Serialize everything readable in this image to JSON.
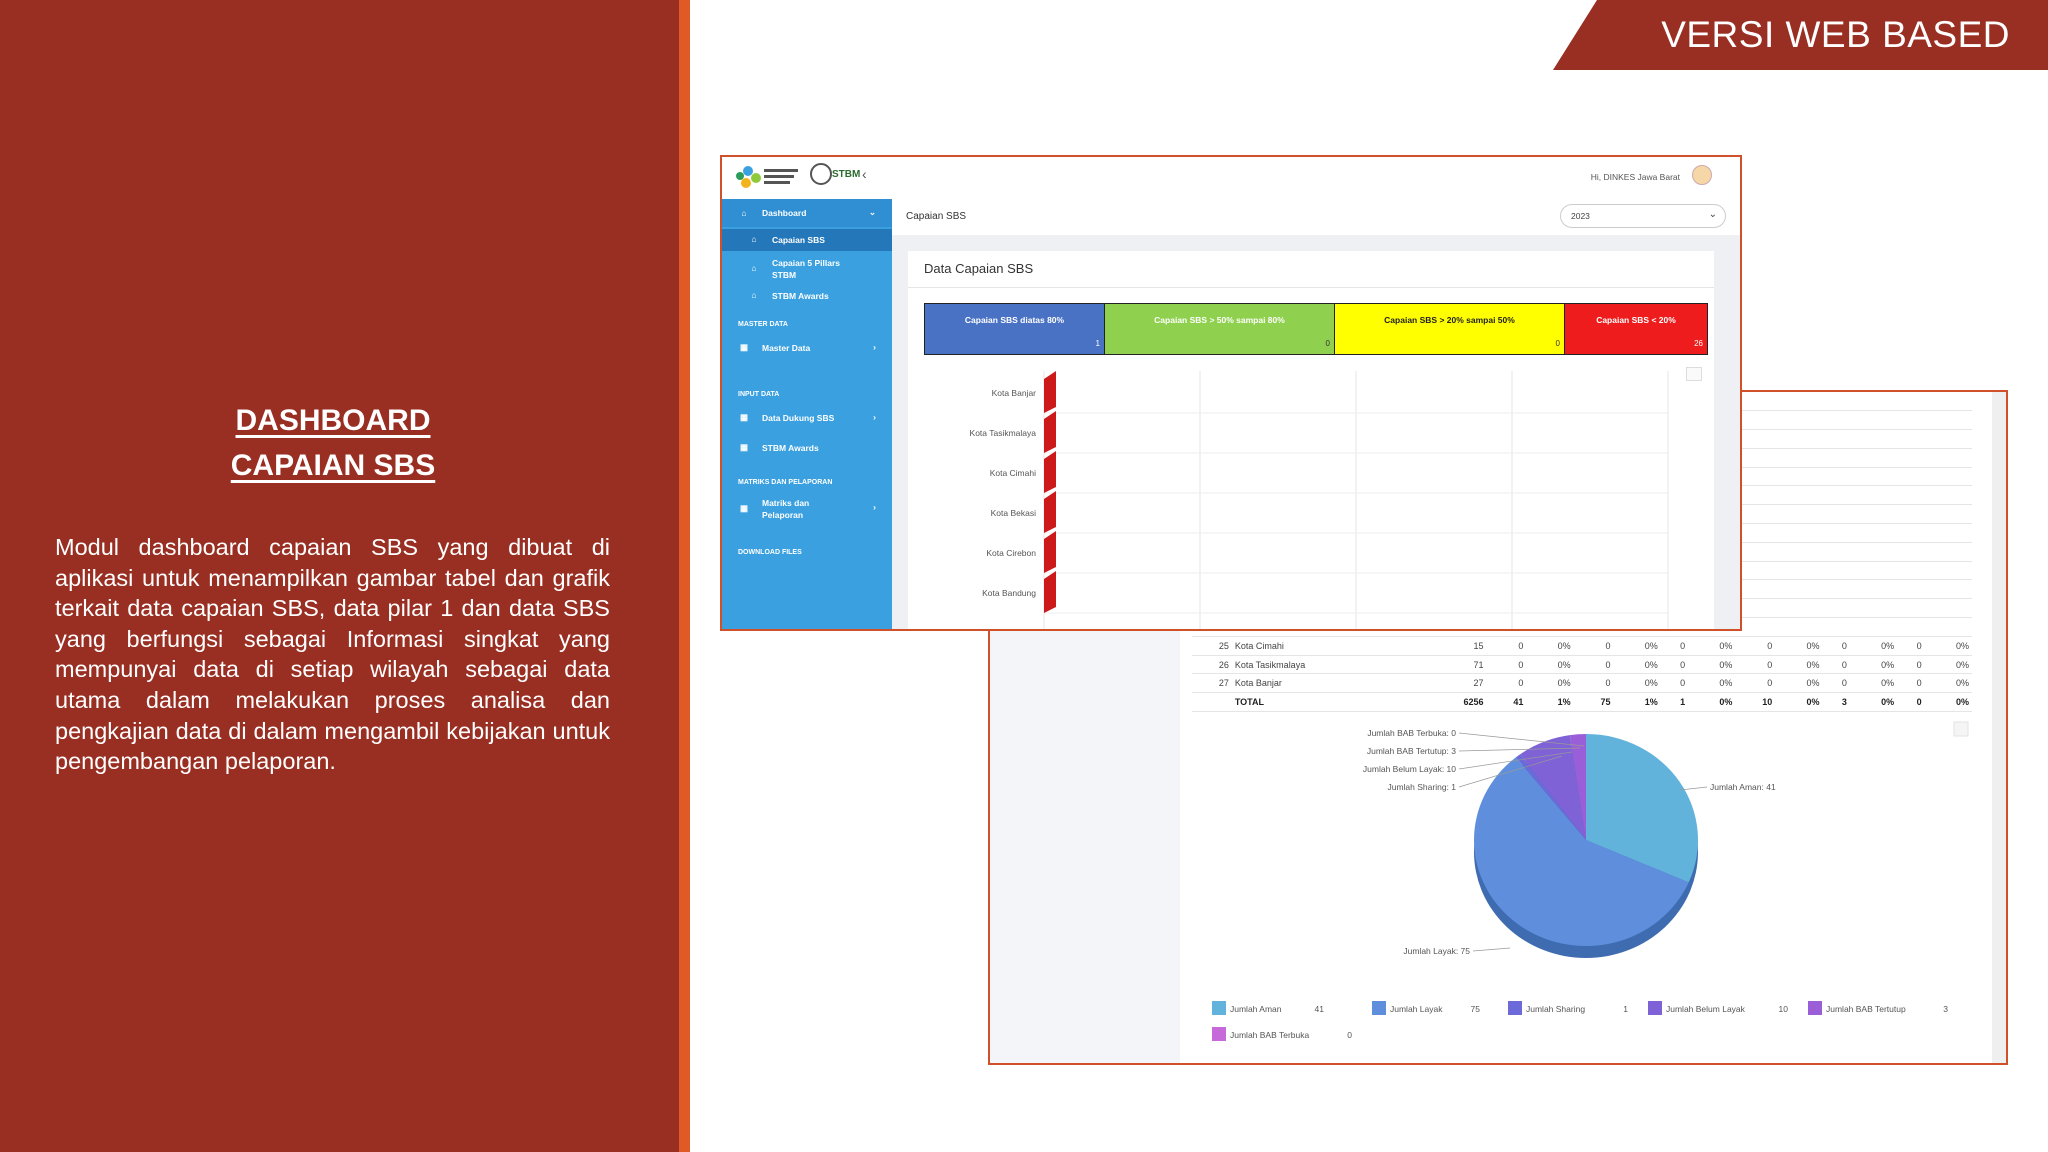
{
  "slide": {
    "banner": "VERSI WEB BASED",
    "title_line1": "DASHBOARD",
    "title_line2": "CAPAIAN SBS",
    "body": "Modul dashboard capaian SBS yang dibuat di aplikasi untuk menampilkan gambar tabel dan grafik terkait data capaian SBS, data pilar 1 dan data SBS yang berfungsi sebagai Informasi singkat yang mempunyai data di setiap wilayah sebagai data utama dalam melakukan proses analisa dan pengkajian data di dalam mengambil kebijakan untuk pengembangan pelaporan."
  },
  "front": {
    "logo_text": "STBM",
    "user_greeting": "Hi, DINKES Jawa Barat",
    "page_title": "Capaian SBS",
    "year_select": "2023",
    "card_title": "Data Capaian SBS",
    "sidebar": {
      "dashboard": "Dashboard",
      "sub_items": [
        "Capaian SBS",
        "Capaian 5 Pillars STBM",
        "STBM Awards"
      ],
      "sec_master": "MASTER DATA",
      "master_data": "Master Data",
      "sec_input": "INPUT DATA",
      "data_dukung": "Data Dukung SBS",
      "stbm_awards": "STBM Awards",
      "sec_matriks": "MATRIKS DAN PELAPORAN",
      "matriks": "Matriks dan Pelaporan",
      "download": "DOWNLOAD FILES"
    },
    "legend": [
      {
        "label": "Capaian SBS diatas 80%",
        "value": "1",
        "color": "#4a72c4"
      },
      {
        "label": "Capaian SBS > 50% sampai 80%",
        "value": "0",
        "color": "#8fd04e"
      },
      {
        "label": "Capaian SBS > 20% sampai 50%",
        "value": "0",
        "color": "#ffff00"
      },
      {
        "label": "Capaian SBS < 20%",
        "value": "26",
        "color": "#ee1c1c"
      }
    ]
  },
  "chart_data": [
    {
      "type": "bar",
      "categories": [
        "Kota Banjar",
        "Kota Tasikmalaya",
        "Kota Cimahi",
        "Kota Bekasi",
        "Kota Cirebon",
        "Kota Bandung"
      ]
    },
    {
      "type": "pie",
      "labels": [
        "Jumlah Aman",
        "Jumlah Layak",
        "Jumlah Sharing",
        "Jumlah Belum Layak",
        "Jumlah BAB Tertutup",
        "Jumlah BAB Terbuka"
      ],
      "values": [
        41,
        75,
        1,
        10,
        3,
        0
      ],
      "callouts": [
        "Jumlah BAB Terbuka: 0",
        "Jumlah BAB Tertutup: 3",
        "Jumlah Belum Layak: 10",
        "Jumlah Sharing: 1",
        "Jumlah Aman: 41",
        "Jumlah Layak: 75"
      ],
      "colors": [
        "#62b3dc",
        "#5f8fdc",
        "#6b6ad8",
        "#7e62d6",
        "#9a5fd8",
        "#c56ad8"
      ],
      "legend_values": [
        "41",
        "75",
        "1",
        "10",
        "3",
        "0"
      ]
    }
  ],
  "back": {
    "rows": [
      {
        "no": "25",
        "name": "Kota Cimahi",
        "c": [
          "15",
          "0",
          "0%",
          "0",
          "0%",
          "0",
          "0%",
          "0",
          "0%",
          "0",
          "0%",
          "0",
          "0%"
        ]
      },
      {
        "no": "26",
        "name": "Kota Tasikmalaya",
        "c": [
          "71",
          "0",
          "0%",
          "0",
          "0%",
          "0",
          "0%",
          "0",
          "0%",
          "0",
          "0%",
          "0",
          "0%"
        ]
      },
      {
        "no": "27",
        "name": "Kota Banjar",
        "c": [
          "27",
          "0",
          "0%",
          "0",
          "0%",
          "0",
          "0%",
          "0",
          "0%",
          "0",
          "0%",
          "0",
          "0%"
        ]
      }
    ],
    "total": {
      "label": "TOTAL",
      "c": [
        "6256",
        "41",
        "1%",
        "75",
        "1%",
        "1",
        "0%",
        "10",
        "0%",
        "3",
        "0%",
        "0",
        "0%"
      ]
    }
  }
}
